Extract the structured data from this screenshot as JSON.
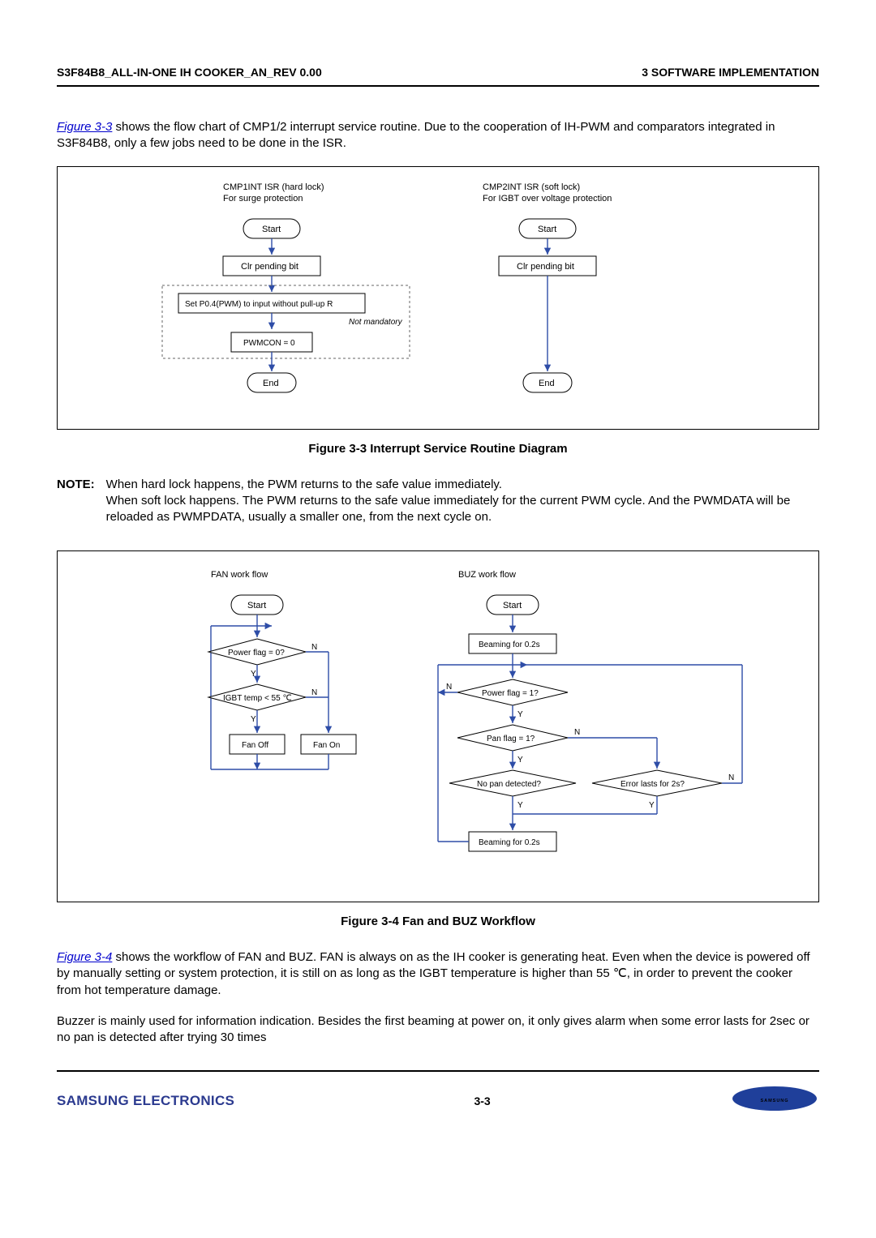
{
  "header": {
    "left": "S3F84B8_ALL-IN-ONE IH COOKER_AN_REV 0.00",
    "right": "3 SOFTWARE IMPLEMENTATION"
  },
  "intro": {
    "link": "Figure 3-3",
    "text_after": " shows the flow chart of CMP1/2 interrupt service routine. Due to the cooperation of IH-PWM and comparators integrated in S3F84B8, only a few jobs need to be done in the ISR."
  },
  "figure33": {
    "caption": "Figure 3-3    Interrupt Service Routine Diagram",
    "left_title1": "CMP1INT ISR (hard lock)",
    "left_title2": "For surge protection",
    "right_title1": "CMP2INT  ISR (soft lock)",
    "right_title2": "For IGBT over voltage protection",
    "start": "Start",
    "clr": "Clr pending bit",
    "setp04": "Set P0.4(PWM) to input without pull-up R",
    "notmand": "Not mandatory",
    "pwmcon": "PWMCON = 0",
    "end": "End"
  },
  "note": {
    "label": "NOTE:",
    "text": "When hard lock happens, the PWM returns to the safe value immediately.\nWhen soft lock happens. The PWM returns to the safe value immediately for the current PWM cycle. And the PWMDATA will be reloaded as PWMPDATA, usually a smaller one, from the next cycle on."
  },
  "figure34": {
    "caption": "Figure 3-4    Fan and BUZ Workflow",
    "fan_title": "FAN work flow",
    "buz_title": "BUZ work flow",
    "start": "Start",
    "powerflag0": "Power flag = 0?",
    "igbt55": "IGBT temp < 55 ℃",
    "fanoff": "Fan Off",
    "fanon": "Fan On",
    "beaming": "Beaming for 0.2s",
    "powerflag1": "Power flag = 1?",
    "panflag1": "Pan flag = 1?",
    "nopan": "No pan detected?",
    "errlast": "Error lasts for 2s?",
    "Y": "Y",
    "N": "N"
  },
  "para34": {
    "link": "Figure 3-4",
    "text_after": " shows the workflow of FAN and BUZ. FAN is always on as the IH cooker is generating heat. Even when the device is powered off by manually setting or system protection, it is still on as long as the IGBT temperature is higher than 55 ℃, in order to prevent the cooker from hot temperature damage."
  },
  "para_buzzer": "Buzzer is mainly used for information indication. Besides the first beaming at power on, it only gives alarm when some error lasts for 2sec or no pan is detected after trying 30 times",
  "footer": {
    "left": "SAMSUNG ELECTRONICS",
    "center": "3-3",
    "logo": "SAMSUNG"
  }
}
